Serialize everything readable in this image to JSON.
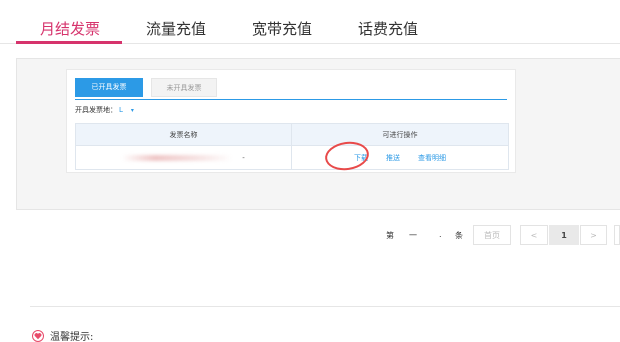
{
  "tabs": [
    {
      "label": "月结发票",
      "active": true
    },
    {
      "label": "流量充值",
      "active": false
    },
    {
      "label": "宽带充值",
      "active": false
    },
    {
      "label": "话费充值",
      "active": false
    }
  ],
  "screenshot": {
    "inner_tabs": [
      "已开具发票",
      "未开具发票"
    ],
    "filter_label": "开具发票地：",
    "filter_value": "L",
    "table": {
      "headers": [
        "发票名称",
        "可进行操作"
      ],
      "row": {
        "dash": "-",
        "actions": [
          "下载",
          "推送",
          "查看明细"
        ]
      }
    }
  },
  "pagination": {
    "prefix": "第",
    "middle": "一",
    "sep": ".",
    "suffix": "条",
    "first_page": "首页",
    "prev": "<",
    "current": "1",
    "next": ">"
  },
  "tip": {
    "label": "温馨提示:"
  },
  "colors": {
    "accent": "#d6336c",
    "link": "#2c9ae6",
    "annotation": "#e84a4a"
  }
}
